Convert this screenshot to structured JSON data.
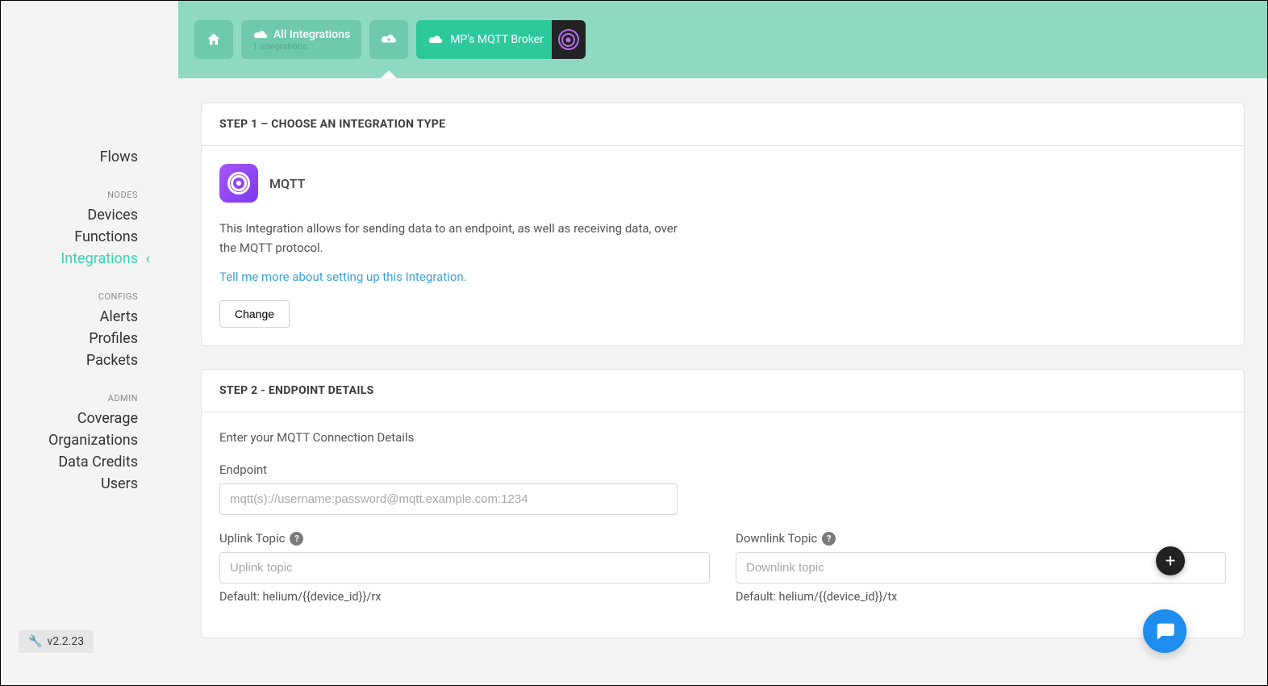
{
  "sidebar": {
    "items": [
      {
        "label": "Flows"
      }
    ],
    "nodes_heading": "NODES",
    "nodes": [
      {
        "label": "Devices"
      },
      {
        "label": "Functions"
      },
      {
        "label": "Integrations",
        "active": true
      }
    ],
    "configs_heading": "CONFIGS",
    "configs": [
      {
        "label": "Alerts"
      },
      {
        "label": "Profiles"
      },
      {
        "label": "Packets"
      }
    ],
    "admin_heading": "ADMIN",
    "admin": [
      {
        "label": "Coverage"
      },
      {
        "label": "Organizations"
      },
      {
        "label": "Data Credits"
      },
      {
        "label": "Users"
      }
    ]
  },
  "version": "v2.2.23",
  "topbar": {
    "all_integrations_label": "All Integrations",
    "all_integrations_count": "1 Integrations",
    "active_tab_label": "MP's MQTT Broker"
  },
  "step1": {
    "header": "STEP 1 – CHOOSE AN INTEGRATION TYPE",
    "integration_name": "MQTT",
    "description": "This Integration allows for sending data to an endpoint, as well as receiving data, over the MQTT protocol.",
    "link_text": "Tell me more about setting up this Integration.",
    "change_button": "Change"
  },
  "step2": {
    "header": "STEP 2 - ENDPOINT DETAILS",
    "intro": "Enter your MQTT Connection Details",
    "endpoint_label": "Endpoint",
    "endpoint_placeholder": "mqtt(s)://username:password@mqtt.example.com:1234",
    "uplink_label": "Uplink Topic",
    "uplink_placeholder": "Uplink topic",
    "uplink_hint": "Default: helium/{{device_id}}/rx",
    "downlink_label": "Downlink Topic",
    "downlink_placeholder": "Downlink topic",
    "downlink_hint": "Default: helium/{{device_id}}/tx"
  }
}
